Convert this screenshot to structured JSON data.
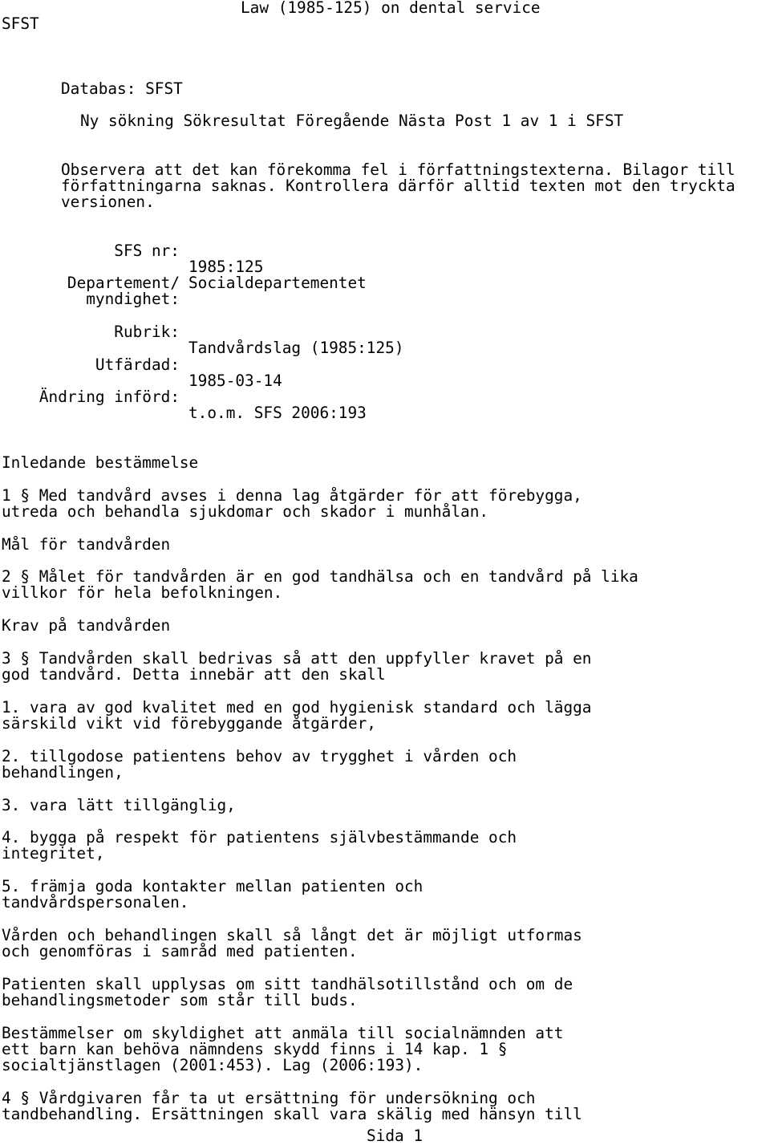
{
  "header": {
    "title": "Law (1985-125) on dental service",
    "source": "SFST"
  },
  "database": {
    "label": "Databas:",
    "value": "SFST"
  },
  "navigation": {
    "new_search": "Ny sökning",
    "results": "Sökresultat",
    "previous": "Föregående",
    "next": "Nästa",
    "position": "Post 1 av 1 i SFST"
  },
  "notice": "Observera att det kan förekomma fel i författningstexterna. Bilagor till författningarna saknas. Kontrollera därför alltid texten mot den tryckta versionen.",
  "metadata": [
    {
      "label": "SFS nr:",
      "value": "1985:125"
    },
    {
      "label": "Departement/\nmyndighet:",
      "value": "Socialdepartementet"
    },
    {
      "label": "Rubrik:",
      "value": "Tandvårdslag (1985:125)"
    },
    {
      "label": "Utfärdad:",
      "value": "1985-03-14"
    },
    {
      "label": "Ändring införd:",
      "value": "t.o.m. SFS 2006:193"
    }
  ],
  "body": [
    {
      "type": "heading",
      "text": "Inledande bestämmelse"
    },
    {
      "type": "paragraph",
      "text": "1 § Med tandvård avses i denna lag åtgärder för att förebygga,\nutreda och behandla sjukdomar och skador i munhålan."
    },
    {
      "type": "heading",
      "text": "Mål för tandvården"
    },
    {
      "type": "paragraph",
      "text": "2 § Målet för tandvården är en god tandhälsa och en tandvård på lika\nvillkor för hela befolkningen."
    },
    {
      "type": "heading",
      "text": "Krav på tandvården"
    },
    {
      "type": "paragraph",
      "text": "3 § Tandvården skall bedrivas så att den uppfyller kravet på en\ngod tandvård. Detta innebär att den skall"
    },
    {
      "type": "list-item",
      "text": "1. vara av god kvalitet med en god hygienisk standard och lägga\nsärskild vikt vid förebyggande åtgärder,"
    },
    {
      "type": "list-item",
      "text": "2. tillgodose patientens behov av trygghet i vården och\nbehandlingen,"
    },
    {
      "type": "list-item",
      "text": "3. vara lätt tillgänglig,"
    },
    {
      "type": "list-item",
      "text": "4. bygga på respekt för patientens självbestämmande och\nintegritet,"
    },
    {
      "type": "list-item",
      "text": "5. främja goda kontakter mellan patienten och\ntandvårdspersonalen."
    },
    {
      "type": "paragraph",
      "text": "Vården och behandlingen skall så långt det är möjligt utformas\noch genomföras i samråd med patienten."
    },
    {
      "type": "paragraph",
      "text": "Patienten skall upplysas om sitt tandhälsotillstånd och om de\nbehandlingsmetoder som står till buds."
    },
    {
      "type": "paragraph",
      "text": "Bestämmelser om skyldighet att anmäla till socialnämnden att\nett barn kan behöva nämndens skydd finns i 14 kap. 1 §\nsocialtjänstlagen (2001:453). Lag (2006:193)."
    },
    {
      "type": "paragraph",
      "text": "4 § Vårdgivaren får ta ut ersättning för undersökning och\ntandbehandling. Ersättningen skall vara skälig med hänsyn till"
    }
  ],
  "footer": {
    "page_label": "Sida 1"
  }
}
